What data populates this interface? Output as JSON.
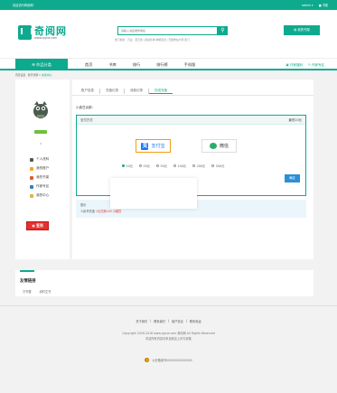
{
  "topbar": {
    "welcome": "欢迎访问奇阅网！",
    "user": "admin ▾",
    "shelf": "■ 书架"
  },
  "header": {
    "logo_name": "奇阅网",
    "logo_url": "www.qiyue.com",
    "search_placeholder": "请输入书名或作者名",
    "hot_text": "热门搜索：万古、圣王墓 | 武动乾坤 神墓圣龙 | 无敌修仙大师 武门",
    "bookshelf_button": "我的书架"
  },
  "nav": {
    "category": "☰ 作品分类",
    "items": [
      "首页",
      "书库",
      "排行",
      "排行榜",
      "手机版"
    ],
    "right_items": [
      "▣ 作家福利",
      "✎ 作家专区"
    ]
  },
  "breadcrumb": {
    "home": "首页设置 · 账号管理 > ",
    "current": "充值中心"
  },
  "sidebar": {
    "menu": [
      "个人资料",
      "我的账户",
      "我的书架",
      "作家专区",
      "我的中心"
    ],
    "menu_colors": [
      "#555555",
      "#f5a623",
      "#e05b2b",
      "#2e7fd1",
      "#e3b23c"
    ],
    "signin": "签到"
  },
  "main": {
    "tabs": [
      "账户信息",
      "充值记录",
      "消费记录",
      "在线充值"
    ],
    "balance": "小森豆余额：",
    "pay_head_left": "支付方式",
    "pay_head_right": "最低10元",
    "alipay": "支付宝",
    "wechat": "微信",
    "amounts": [
      "10元",
      "20元",
      "50元",
      "100元",
      "200元",
      "500元"
    ],
    "selected_amount": "10元",
    "confirm": "确定",
    "tip_title": "提示",
    "tip_prefix": "人民币充值 ",
    "tip_ratio": "1元兑换100 小森豆",
    "tip_suffix": ""
  },
  "links": {
    "title": "友情链接",
    "items": [
      "万书楼",
      "阅时文书"
    ]
  },
  "footer": {
    "links": [
      "关于我们",
      "|",
      "联系我们",
      "|",
      "用户协议",
      "|",
      "联系电话"
    ],
    "copyright": "Copyright 2016-2018 www.qiyue.com 奇阅网 All Rights Reserved",
    "tip": "本站所有内容均来自网友上传与收集",
    "police": "公安备案号00000000000000"
  }
}
